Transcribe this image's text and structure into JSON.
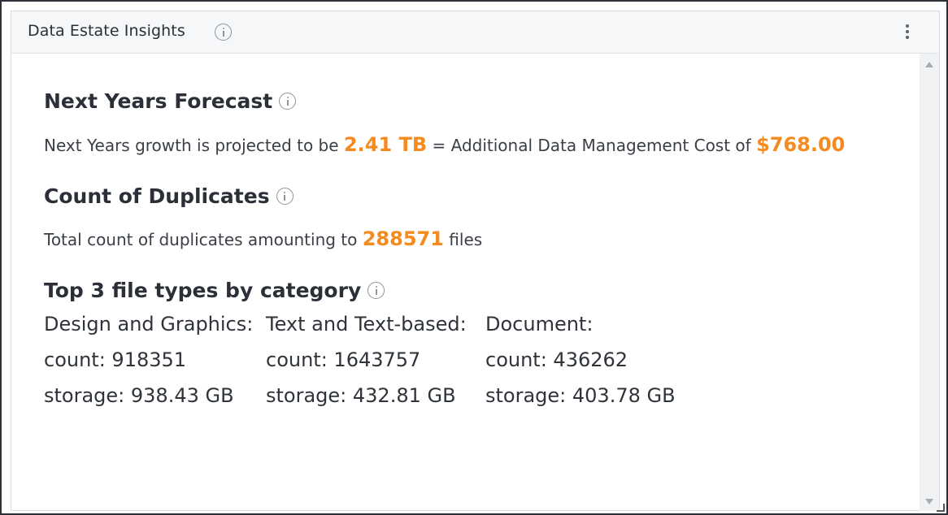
{
  "card": {
    "title": "Data Estate Insights"
  },
  "forecast": {
    "heading": "Next Years Forecast",
    "prefix": "Next Years growth is projected to be",
    "growth": "2.41 TB",
    "middle": "= Additional Data Management Cost of",
    "cost": "$768.00"
  },
  "duplicates": {
    "heading": "Count of Duplicates",
    "prefix": "Total count of duplicates amounting to",
    "count": "288571",
    "suffix": "files"
  },
  "file_types": {
    "heading": "Top 3 file types by category",
    "categories": [
      {
        "name": "Design and Graphics:",
        "count": "count: 918351",
        "storage": "storage: 938.43 GB"
      },
      {
        "name": "Text and Text-based:",
        "count": "count: 1643757",
        "storage": "storage: 432.81 GB"
      },
      {
        "name": "Document:",
        "count": "count: 436262",
        "storage": "storage: 403.78 GB"
      }
    ]
  },
  "colors": {
    "highlight": "#f58a1f",
    "header_bg": "#f6f7f9"
  }
}
